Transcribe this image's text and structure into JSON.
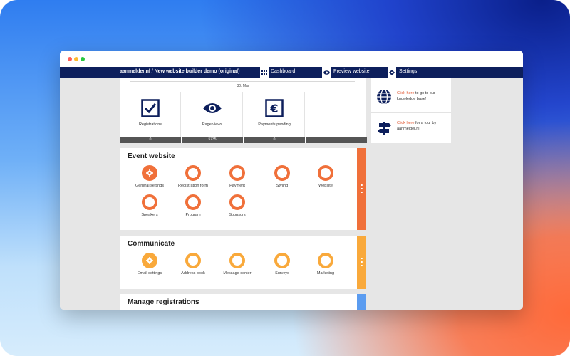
{
  "colors": {
    "navy": "#0d1f5c",
    "orange": "#f0703a",
    "amber": "#f9a93b",
    "blue": "#5b9cf0",
    "gray_bar": "#555555"
  },
  "navbar": {
    "title": "aanmelder.nl / New website builder demo (original)",
    "dashboard_icon": "grid-icon",
    "dashboard_label": "Dashboard",
    "preview_icon": "eye-icon",
    "preview_label": "Preview website",
    "settings_icon": "gear-icon",
    "settings_label": "Settings"
  },
  "stats": {
    "date": "30. Mar",
    "items": [
      {
        "icon": "checkbox-icon",
        "label": "Registrations",
        "count": "0"
      },
      {
        "icon": "eye-icon",
        "label": "Page views",
        "count": "5735"
      },
      {
        "icon": "euro-icon",
        "label": "Payments pending",
        "count": "0"
      }
    ]
  },
  "event_website": {
    "title": "Event website",
    "items": [
      {
        "label": "General settings",
        "icon": "gear-icon"
      },
      {
        "label": "Registration form"
      },
      {
        "label": "Payment"
      },
      {
        "label": "Styling"
      },
      {
        "label": "Website"
      },
      {
        "label": "Speakers"
      },
      {
        "label": "Program"
      },
      {
        "label": "Sponsors"
      }
    ]
  },
  "communicate": {
    "title": "Communicate",
    "items": [
      {
        "label": "Email settings",
        "icon": "gear-icon"
      },
      {
        "label": "Address book"
      },
      {
        "label": "Message center"
      },
      {
        "label": "Surveys"
      },
      {
        "label": "Marketing"
      }
    ]
  },
  "manage_registrations": {
    "title": "Manage registrations"
  },
  "sidebar": {
    "knowledge": {
      "icon": "globe-icon",
      "link": "Click here",
      "text": " to go to our knowledge base!"
    },
    "tour": {
      "icon": "signpost-icon",
      "link": "Click here",
      "text": " for a tour by aanmelder.nl"
    }
  }
}
